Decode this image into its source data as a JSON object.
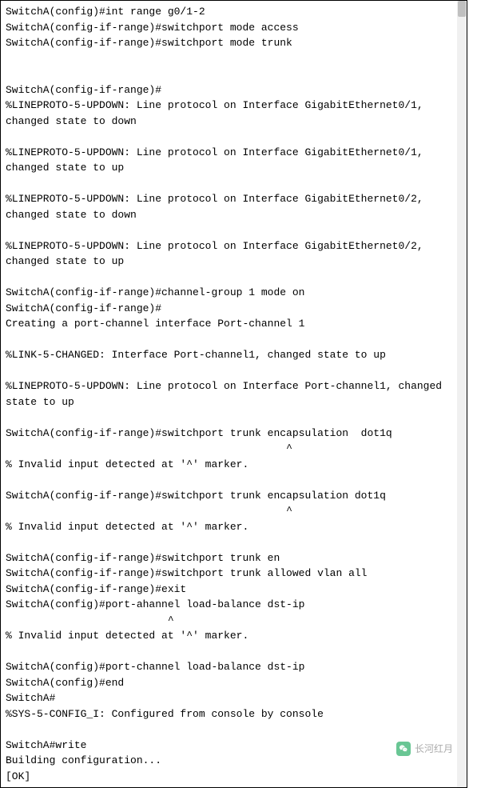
{
  "terminal": {
    "lines": [
      "SwitchA(config)#int range g0/1-2",
      "SwitchA(config-if-range)#switchport mode access",
      "SwitchA(config-if-range)#switchport mode trunk",
      "",
      "",
      "SwitchA(config-if-range)#",
      "%LINEPROTO-5-UPDOWN: Line protocol on Interface GigabitEthernet0/1, changed state to down",
      "",
      "%LINEPROTO-5-UPDOWN: Line protocol on Interface GigabitEthernet0/1, changed state to up",
      "",
      "%LINEPROTO-5-UPDOWN: Line protocol on Interface GigabitEthernet0/2, changed state to down",
      "",
      "%LINEPROTO-5-UPDOWN: Line protocol on Interface GigabitEthernet0/2, changed state to up",
      "",
      "SwitchA(config-if-range)#channel-group 1 mode on",
      "SwitchA(config-if-range)#",
      "Creating a port-channel interface Port-channel 1",
      "",
      "%LINK-5-CHANGED: Interface Port-channel1, changed state to up",
      "",
      "%LINEPROTO-5-UPDOWN: Line protocol on Interface Port-channel1, changed state to up",
      "",
      "SwitchA(config-if-range)#switchport trunk encapsulation  dot1q",
      "                                             ^",
      "% Invalid input detected at '^' marker.",
      "",
      "SwitchA(config-if-range)#switchport trunk encapsulation dot1q",
      "                                             ^",
      "% Invalid input detected at '^' marker.",
      "",
      "SwitchA(config-if-range)#switchport trunk en",
      "SwitchA(config-if-range)#switchport trunk allowed vlan all",
      "SwitchA(config-if-range)#exit",
      "SwitchA(config)#port-ahannel load-balance dst-ip",
      "                          ^",
      "% Invalid input detected at '^' marker.",
      "",
      "SwitchA(config)#port-channel load-balance dst-ip",
      "SwitchA(config)#end",
      "SwitchA#",
      "%SYS-5-CONFIG_I: Configured from console by console",
      "",
      "SwitchA#write",
      "Building configuration...",
      "[OK]"
    ]
  },
  "watermark": {
    "text": "长河红月"
  }
}
